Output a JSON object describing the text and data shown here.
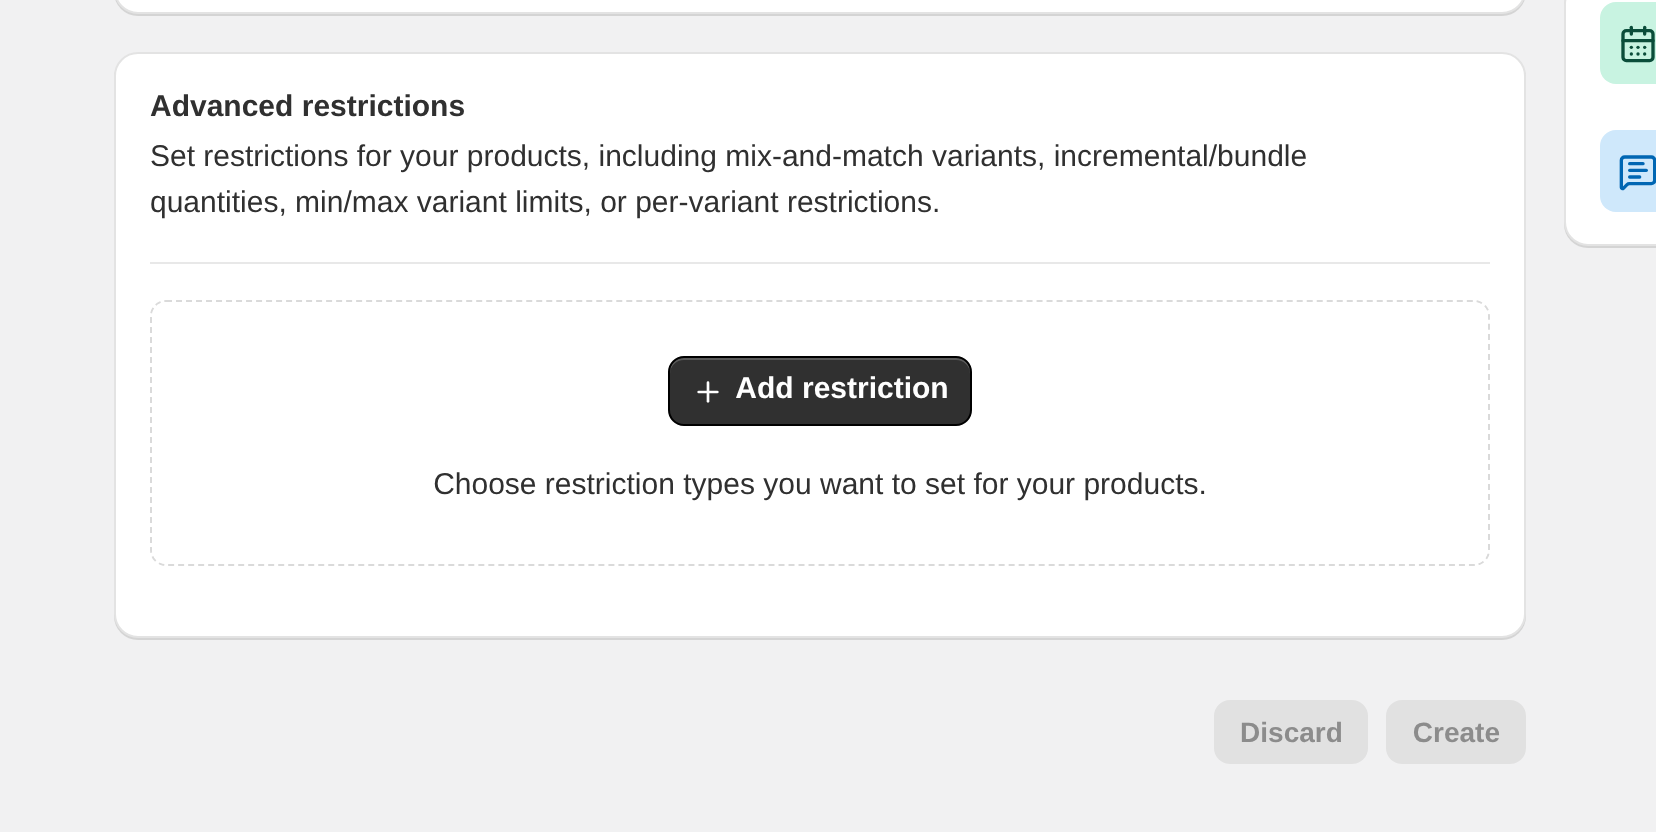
{
  "card": {
    "title": "Advanced restrictions",
    "description": "Set restrictions for your products, including mix-and-match variants, incremental/bundle quantities, min/max variant limits, or per-variant restrictions.",
    "add_button": "Add restriction",
    "hint": "Choose restriction types you want to set for your products."
  },
  "footer_buttons": [
    {
      "label": "Discard",
      "disabled": true
    },
    {
      "label": "Create",
      "disabled": true
    }
  ]
}
